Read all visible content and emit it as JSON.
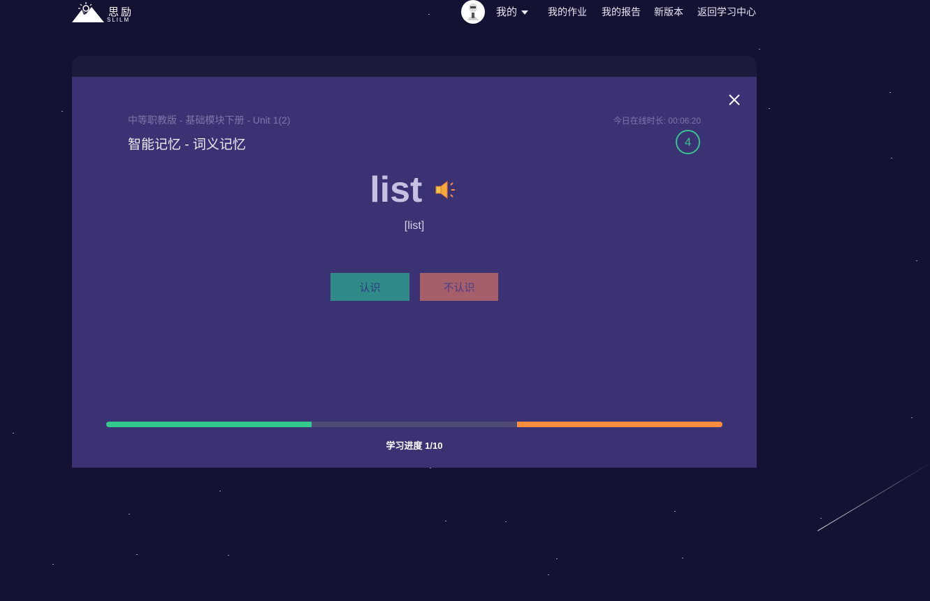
{
  "nav": {
    "logo_cn": "思励",
    "logo_en": "SLILM",
    "my_label": "我的",
    "homework": "我的作业",
    "report": "我的报告",
    "new_version": "新版本",
    "back_center": "返回学习中心"
  },
  "card": {
    "breadcrumb": "中等职教版 - 基础模块下册 - Unit 1(2)",
    "mode_title": "智能记忆 - 词义记忆",
    "online_time": "今日在线时长: 00:06:20",
    "counter": "4",
    "word": "list",
    "phonetic": "[list]",
    "know_label": "认识",
    "unknown_label": "不认识",
    "progress_label": "学习进度 1/10",
    "progress": {
      "learned_fraction": 0.333,
      "unknown_fraction": 0.333,
      "learned_color": "#35c990",
      "unknown_color": "#ff8b3d",
      "track_color": "#4e4a78"
    }
  },
  "icons": {
    "close": "close-icon",
    "speaker": "speaker-icon",
    "dropdown": "caret-down-icon",
    "avatar": "avatar"
  },
  "colors": {
    "background": "#141233",
    "panel": "#3a3272",
    "accent_green": "#36c48f",
    "accent_orange": "#ff8b3d"
  }
}
